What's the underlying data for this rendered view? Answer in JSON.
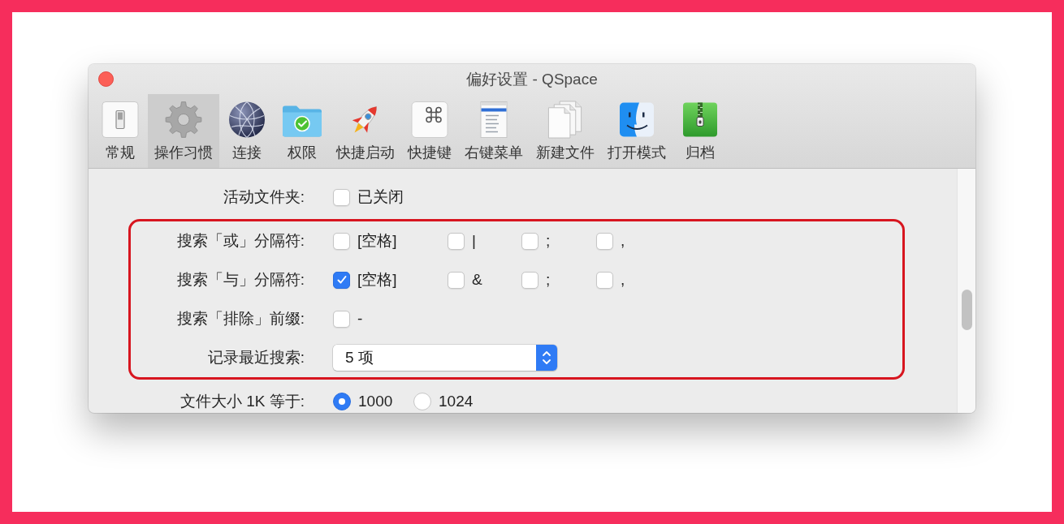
{
  "window": {
    "title": "偏好设置 - QSpace"
  },
  "toolbar": [
    {
      "label": "常规",
      "selected": false
    },
    {
      "label": "操作习惯",
      "selected": true
    },
    {
      "label": "连接",
      "selected": false
    },
    {
      "label": "权限",
      "selected": false
    },
    {
      "label": "快捷启动",
      "selected": false
    },
    {
      "label": "快捷键",
      "selected": false
    },
    {
      "label": "右键菜单",
      "selected": false
    },
    {
      "label": "新建文件",
      "selected": false
    },
    {
      "label": "打开模式",
      "selected": false
    },
    {
      "label": "归档",
      "selected": false
    }
  ],
  "sections": [
    {
      "highlighted": false,
      "rows": [
        {
          "kind": "checkboxes",
          "label": "活动文件夹:",
          "options": [
            {
              "label": "已关闭",
              "checked": false
            }
          ]
        }
      ]
    },
    {
      "highlighted": true,
      "rows": [
        {
          "kind": "checkboxes",
          "label": "搜索「或」分隔符:",
          "options": [
            {
              "label": "[空格]",
              "checked": false
            },
            {
              "label": "|",
              "checked": false
            },
            {
              "label": ";",
              "checked": false
            },
            {
              "label": ",",
              "checked": false
            }
          ]
        },
        {
          "kind": "checkboxes",
          "label": "搜索「与」分隔符:",
          "options": [
            {
              "label": "[空格]",
              "checked": true
            },
            {
              "label": "&",
              "checked": false
            },
            {
              "label": ";",
              "checked": false
            },
            {
              "label": ",",
              "checked": false
            }
          ]
        },
        {
          "kind": "checkboxes",
          "label": "搜索「排除」前缀:",
          "options": [
            {
              "label": "-",
              "checked": false
            }
          ]
        },
        {
          "kind": "select",
          "label": "记录最近搜索:",
          "value": "5 项"
        }
      ]
    },
    {
      "highlighted": false,
      "rows": [
        {
          "kind": "radios",
          "label": "文件大小 1K 等于:",
          "options": [
            {
              "label": "1000",
              "selected": true
            },
            {
              "label": "1024",
              "selected": false
            }
          ]
        }
      ]
    }
  ]
}
